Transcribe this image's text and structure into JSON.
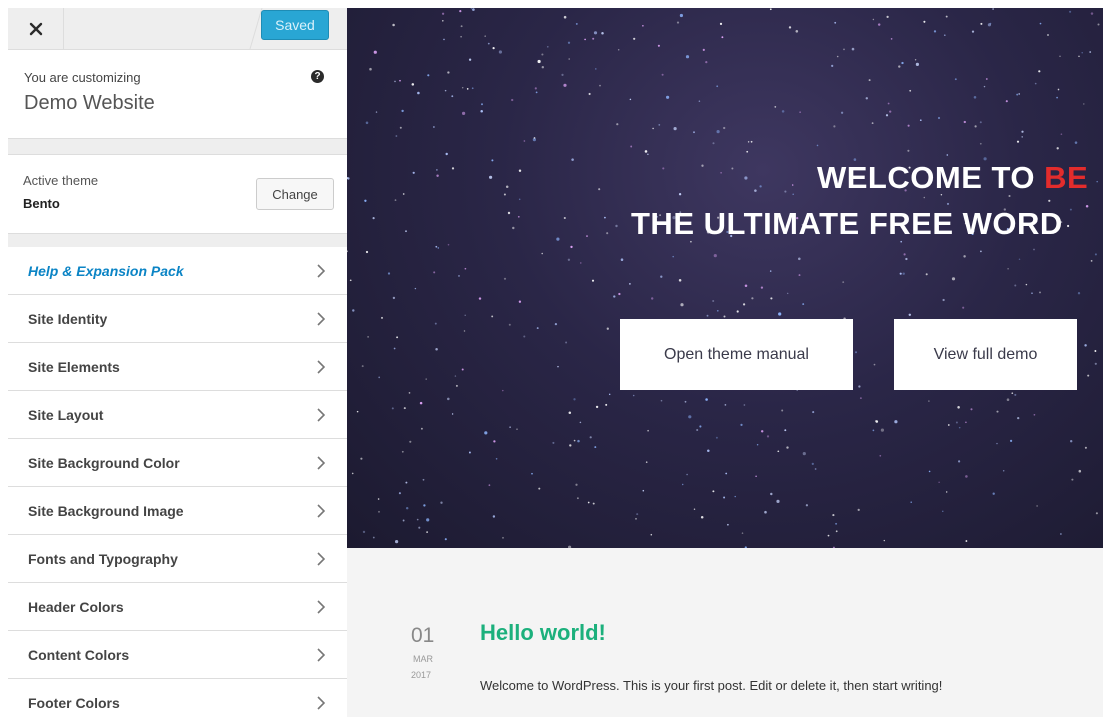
{
  "header": {
    "close_icon": "close-icon",
    "saved_label": "Saved"
  },
  "info": {
    "pre_text": "You are customizing",
    "site_name": "Demo Website",
    "help_icon": "question-circle-icon"
  },
  "theme": {
    "label": "Active theme",
    "name": "Bento",
    "change_label": "Change"
  },
  "menu": {
    "items": [
      {
        "label": "Help & Expansion Pack"
      },
      {
        "label": "Site Identity"
      },
      {
        "label": "Site Elements"
      },
      {
        "label": "Site Layout"
      },
      {
        "label": "Site Background Color"
      },
      {
        "label": "Site Background Image"
      },
      {
        "label": "Fonts and Typography"
      },
      {
        "label": "Header Colors"
      },
      {
        "label": "Content Colors"
      },
      {
        "label": "Footer Colors"
      }
    ],
    "chevron_icon": "chevron-right-icon"
  },
  "preview": {
    "hero": {
      "line1_prefix": "WELCOME TO ",
      "line1_accent": "BE",
      "line2": "THE ULTIMATE FREE WORD",
      "button1": "Open theme manual",
      "button2": "View full demo"
    },
    "post": {
      "day": "01",
      "month": "MAR",
      "year": "2017",
      "title": "Hello world!",
      "excerpt": "Welcome to WordPress. This is your first post. Edit or delete it, then start writing!"
    }
  },
  "colors": {
    "saved_button": "#29a6d4",
    "help_link": "#0b84c5",
    "accent_red": "#e32c2c",
    "post_title": "#1cb07c",
    "hero_bg": "#2a2647"
  }
}
